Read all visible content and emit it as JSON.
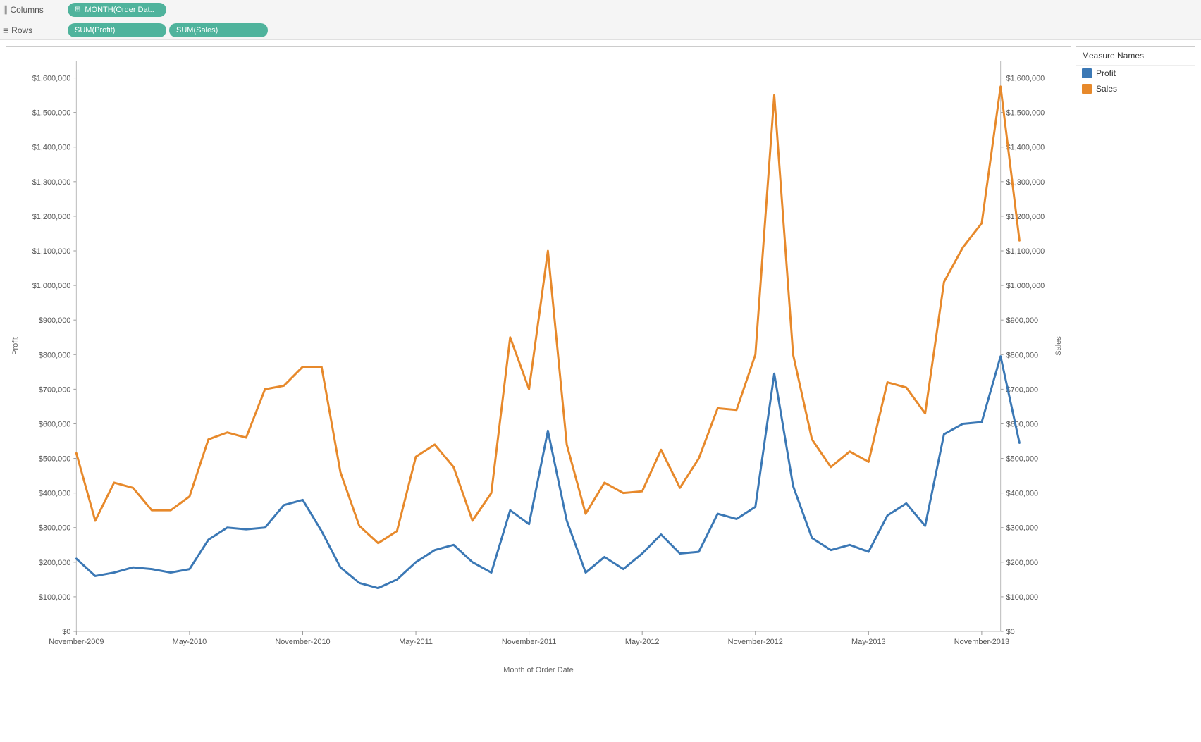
{
  "shelves": {
    "columns_label": "Columns",
    "rows_label": "Rows",
    "columns_pills": [
      {
        "label": "MONTH(Order Dat..",
        "icon": "⊞"
      }
    ],
    "rows_pills": [
      {
        "label": "SUM(Profit)"
      },
      {
        "label": "SUM(Sales)"
      }
    ]
  },
  "legend": {
    "title": "Measure Names",
    "items": [
      {
        "label": "Profit",
        "color": "#3b78b5"
      },
      {
        "label": "Sales",
        "color": "#e7892b"
      }
    ]
  },
  "chart_data": {
    "type": "line",
    "xlabel": "Month of Order Date",
    "y1label": "Profit",
    "y2label": "Sales",
    "y1_range": [
      0,
      1650000
    ],
    "y2_range": [
      0,
      1650000
    ],
    "y_ticks": [
      0,
      100000,
      200000,
      300000,
      400000,
      500000,
      600000,
      700000,
      800000,
      900000,
      1000000,
      1100000,
      1200000,
      1300000,
      1400000,
      1500000,
      1600000
    ],
    "y_tick_labels": [
      "$0",
      "$100,000",
      "$200,000",
      "$300,000",
      "$400,000",
      "$500,000",
      "$600,000",
      "$700,000",
      "$800,000",
      "$900,000",
      "$1,000,000",
      "$1,100,000",
      "$1,200,000",
      "$1,300,000",
      "$1,400,000",
      "$1,500,000",
      "$1,600,000"
    ],
    "x_categories": [
      "November-2009",
      "December-2009",
      "January-2010",
      "February-2010",
      "March-2010",
      "April-2010",
      "May-2010",
      "June-2010",
      "July-2010",
      "August-2010",
      "September-2010",
      "October-2010",
      "November-2010",
      "December-2010",
      "January-2011",
      "February-2011",
      "March-2011",
      "April-2011",
      "May-2011",
      "June-2011",
      "July-2011",
      "August-2011",
      "September-2011",
      "October-2011",
      "November-2011",
      "December-2011",
      "January-2012",
      "February-2012",
      "March-2012",
      "April-2012",
      "May-2012",
      "June-2012",
      "July-2012",
      "August-2012",
      "September-2012",
      "October-2012",
      "November-2012",
      "December-2012",
      "January-2013",
      "February-2013",
      "March-2013",
      "April-2013",
      "May-2013",
      "June-2013",
      "July-2013",
      "August-2013",
      "September-2013",
      "October-2013",
      "November-2013",
      "December-2013"
    ],
    "x_tick_labels": [
      "November-2009",
      "May-2010",
      "November-2010",
      "May-2011",
      "November-2011",
      "May-2012",
      "November-2012",
      "May-2013",
      "November-2013"
    ],
    "x_tick_indices": [
      0,
      6,
      12,
      18,
      24,
      30,
      36,
      42,
      48
    ],
    "series": [
      {
        "name": "Profit",
        "axis": "y1",
        "color": "#3b78b5",
        "values": [
          210000,
          160000,
          170000,
          185000,
          180000,
          170000,
          180000,
          265000,
          300000,
          295000,
          300000,
          365000,
          380000,
          290000,
          185000,
          140000,
          125000,
          150000,
          200000,
          235000,
          250000,
          200000,
          170000,
          350000,
          310000,
          580000,
          320000,
          170000,
          215000,
          180000,
          225000,
          280000,
          225000,
          230000,
          340000,
          325000,
          360000,
          745000,
          420000,
          270000,
          235000,
          250000,
          230000,
          335000,
          370000,
          305000,
          570000,
          600000,
          605000,
          795000,
          545000
        ]
      },
      {
        "name": "Sales",
        "axis": "y2",
        "color": "#e7892b",
        "values": [
          515000,
          320000,
          430000,
          415000,
          350000,
          350000,
          390000,
          555000,
          575000,
          560000,
          700000,
          710000,
          765000,
          765000,
          460000,
          305000,
          255000,
          290000,
          505000,
          540000,
          475000,
          320000,
          400000,
          850000,
          700000,
          1100000,
          540000,
          340000,
          430000,
          400000,
          405000,
          525000,
          415000,
          500000,
          645000,
          640000,
          800000,
          1550000,
          800000,
          555000,
          475000,
          520000,
          490000,
          720000,
          705000,
          630000,
          1010000,
          1110000,
          1180000,
          1575000,
          1130000
        ]
      }
    ]
  }
}
